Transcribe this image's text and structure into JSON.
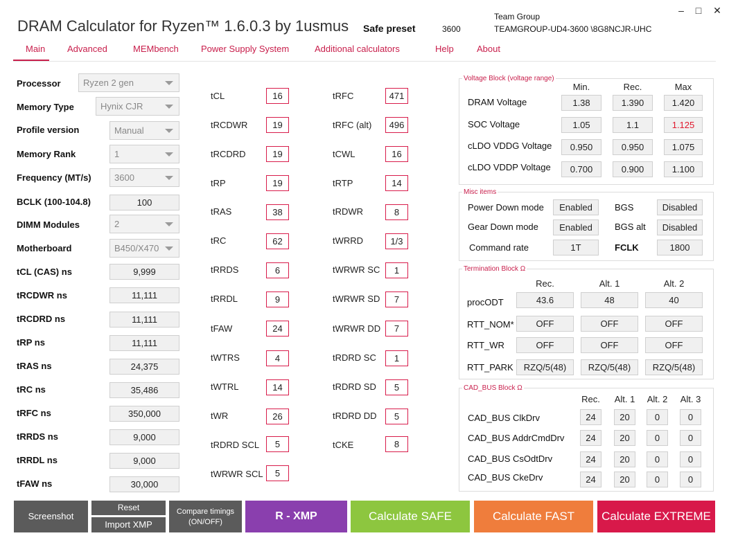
{
  "app": {
    "title": "DRAM Calculator for Ryzen™ 1.6.0.3 by 1usmus",
    "preset_label": "Safe preset",
    "preset_freq": "3600",
    "team_brand": "Team Group",
    "team_part": "TEAMGROUP-UD4-3600 \\8G8NCJR-UHC"
  },
  "window": {
    "minimize": "–",
    "maximize": "□",
    "close": "✕"
  },
  "menu": [
    "Main",
    "Advanced",
    "MEMbench",
    "Power Supply System",
    "Additional calculators",
    "Help",
    "About"
  ],
  "settings": [
    {
      "label": "Processor",
      "value": "Ryzen 2 gen"
    },
    {
      "label": "Memory Type",
      "value": "Hynix CJR"
    },
    {
      "label": "Profile version",
      "value": "Manual"
    },
    {
      "label": "Memory Rank",
      "value": "1"
    },
    {
      "label": "Frequency (MT/s)",
      "value": "3600"
    },
    {
      "label": "BCLK (100-104.8)",
      "value": "100"
    },
    {
      "label": "DIMM Modules",
      "value": "2"
    },
    {
      "label": "Motherboard",
      "value": "B450/X470"
    }
  ],
  "ns_values": [
    {
      "label": "tCL (CAS) ns",
      "value": "9,999"
    },
    {
      "label": "tRCDWR ns",
      "value": "11,111"
    },
    {
      "label": "tRCDRD ns",
      "value": "11,111"
    },
    {
      "label": "tRP ns",
      "value": "11,111"
    },
    {
      "label": "tRAS ns",
      "value": "24,375"
    },
    {
      "label": "tRC ns",
      "value": "35,486"
    },
    {
      "label": "tRFC ns",
      "value": "350,000"
    },
    {
      "label": "tRRDS ns",
      "value": "9,000"
    },
    {
      "label": "tRRDL ns",
      "value": "9,000"
    },
    {
      "label": "tFAW ns",
      "value": "30,000"
    }
  ],
  "timings_a": [
    {
      "label": "tCL",
      "value": "16"
    },
    {
      "label": "tRCDWR",
      "value": "19"
    },
    {
      "label": "tRCDRD",
      "value": "19"
    },
    {
      "label": "tRP",
      "value": "19"
    },
    {
      "label": "tRAS",
      "value": "38"
    },
    {
      "label": "tRC",
      "value": "62"
    },
    {
      "label": "tRRDS",
      "value": "6"
    },
    {
      "label": "tRRDL",
      "value": "9"
    },
    {
      "label": "tFAW",
      "value": "24"
    },
    {
      "label": "tWTRS",
      "value": "4"
    },
    {
      "label": "tWTRL",
      "value": "14"
    },
    {
      "label": "tWR",
      "value": "26"
    },
    {
      "label": "tRDRD SCL",
      "value": "5"
    },
    {
      "label": "tWRWR SCL",
      "value": "5"
    }
  ],
  "timings_b": [
    {
      "label": "tRFC",
      "value": "471"
    },
    {
      "label": "tRFC (alt)",
      "value": "496"
    },
    {
      "label": "tCWL",
      "value": "16"
    },
    {
      "label": "tRTP",
      "value": "14"
    },
    {
      "label": "tRDWR",
      "value": "8"
    },
    {
      "label": "tWRRD",
      "value": "1/3"
    },
    {
      "label": "tWRWR SC",
      "value": "1"
    },
    {
      "label": "tWRWR SD",
      "value": "7"
    },
    {
      "label": "tWRWR DD",
      "value": "7"
    },
    {
      "label": "tRDRD SC",
      "value": "1"
    },
    {
      "label": "tRDRD SD",
      "value": "5"
    },
    {
      "label": "tRDRD DD",
      "value": "5"
    },
    {
      "label": "tCKE",
      "value": "8"
    }
  ],
  "voltage": {
    "title": "Voltage Block (voltage range)",
    "headers": [
      "Min.",
      "Rec.",
      "Max"
    ],
    "rows": [
      {
        "label": "DRAM Voltage",
        "min": "1.38",
        "rec": "1.390",
        "max": "1.420"
      },
      {
        "label": "SOC Voltage",
        "min": "1.05",
        "rec": "1.1",
        "max": "1.125"
      },
      {
        "label": "cLDO VDDG Voltage",
        "min": "0.950",
        "rec": "0.950",
        "max": "1.075"
      },
      {
        "label": "cLDO VDDP Voltage",
        "min": "0.700",
        "rec": "0.900",
        "max": "1.100"
      }
    ],
    "warn_color": "#e0182d"
  },
  "misc": {
    "title": "Misc items",
    "power_down_label": "Power Down mode",
    "power_down_value": "Enabled",
    "bgs_label": "BGS",
    "bgs_value": "Disabled",
    "gear_down_label": "Gear Down mode",
    "gear_down_value": "Enabled",
    "bgs_alt_label": "BGS alt",
    "bgs_alt_value": "Disabled",
    "cmd_rate_label": "Command rate",
    "cmd_rate_value": "1T",
    "fclk_label": "FCLK",
    "fclk_value": "1800"
  },
  "termination": {
    "title": "Termination Block Ω",
    "headers": [
      "Rec.",
      "Alt. 1",
      "Alt. 2"
    ],
    "rows": [
      {
        "label": "procODT",
        "values": [
          "43.6",
          "48",
          "40"
        ]
      },
      {
        "label": "RTT_NOM*",
        "values": [
          "OFF",
          "OFF",
          "OFF"
        ]
      },
      {
        "label": "RTT_WR",
        "values": [
          "OFF",
          "OFF",
          "OFF"
        ]
      },
      {
        "label": "RTT_PARK",
        "values": [
          "RZQ/5(48)",
          "RZQ/5(48)",
          "RZQ/5(48)"
        ]
      }
    ]
  },
  "cadbus": {
    "title": "CAD_BUS Block Ω",
    "headers": [
      "Rec.",
      "Alt. 1",
      "Alt. 2",
      "Alt. 3"
    ],
    "rows": [
      {
        "label": "CAD_BUS ClkDrv",
        "values": [
          "24",
          "20",
          "0",
          "0"
        ]
      },
      {
        "label": "CAD_BUS AddrCmdDrv",
        "values": [
          "24",
          "20",
          "0",
          "0"
        ]
      },
      {
        "label": "CAD_BUS CsOdtDrv",
        "values": [
          "24",
          "20",
          "0",
          "0"
        ]
      },
      {
        "label": "CAD_BUS CkeDrv",
        "values": [
          "24",
          "20",
          "0",
          "0"
        ]
      }
    ]
  },
  "buttons": {
    "screenshot": "Screenshot",
    "reset": "Reset",
    "import_xmp": "Import XMP",
    "compare_line1": "Compare timings",
    "compare_line2": "(ON/OFF)",
    "rxmp": "R - XMP",
    "safe": "Calculate SAFE",
    "fast": "Calculate FAST",
    "extreme": "Calculate EXTREME"
  },
  "colors": {
    "accent": "#c81e4b",
    "gray_btn": "#5b5b5b",
    "purple": "#8a3fae",
    "green": "#8dc63f",
    "orange": "#ef7d3c",
    "red": "#d8194a"
  }
}
